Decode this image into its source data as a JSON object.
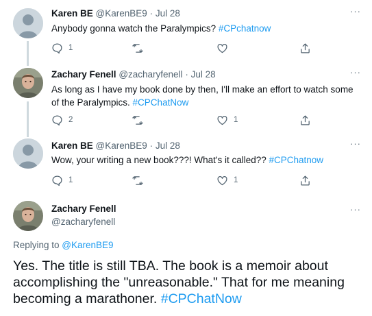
{
  "tweets": [
    {
      "name": "Karen BE",
      "handle": "@KarenBE9",
      "dot": "·",
      "date": "Jul 28",
      "text_plain": "Anybody gonna watch the Paralympics? ",
      "hashtag": "#CPchatnow",
      "reply_count": "1",
      "retweet_count": "",
      "like_count": ""
    },
    {
      "name": "Zachary Fenell",
      "handle": "@zacharyfenell",
      "dot": "·",
      "date": "Jul 28",
      "text_plain": "As long as I have my book done by then, I'll make an effort to watch some of the Paralympics. ",
      "hashtag": "#CPChatNow",
      "reply_count": "2",
      "retweet_count": "",
      "like_count": "1"
    },
    {
      "name": "Karen BE",
      "handle": "@KarenBE9",
      "dot": "·",
      "date": "Jul 28",
      "text_plain": "Wow, your writing a new book???! What's it called?? ",
      "hashtag": "#CPChatnow",
      "reply_count": "1",
      "retweet_count": "",
      "like_count": "1"
    }
  ],
  "main_tweet": {
    "name": "Zachary Fenell",
    "handle": "@zacharyfenell",
    "replying_to_label": "Replying to ",
    "replying_to_handle": "@KarenBE9",
    "text_plain": "Yes. The title is still TBA. The book is a memoir about accomplishing the \"unreasonable.\" That for me meaning becoming a marathoner. ",
    "hashtag": "#CPChatNow"
  },
  "more_label": "···",
  "colors": {
    "accent": "#1d9bf0",
    "secondary_text": "#536471",
    "primary_text": "#0f1419",
    "thread_line": "#cfd9de"
  },
  "icons": [
    "default-avatar-icon",
    "profile-photo-icon",
    "more-icon",
    "reply-icon",
    "retweet-icon",
    "like-icon",
    "share-icon"
  ]
}
